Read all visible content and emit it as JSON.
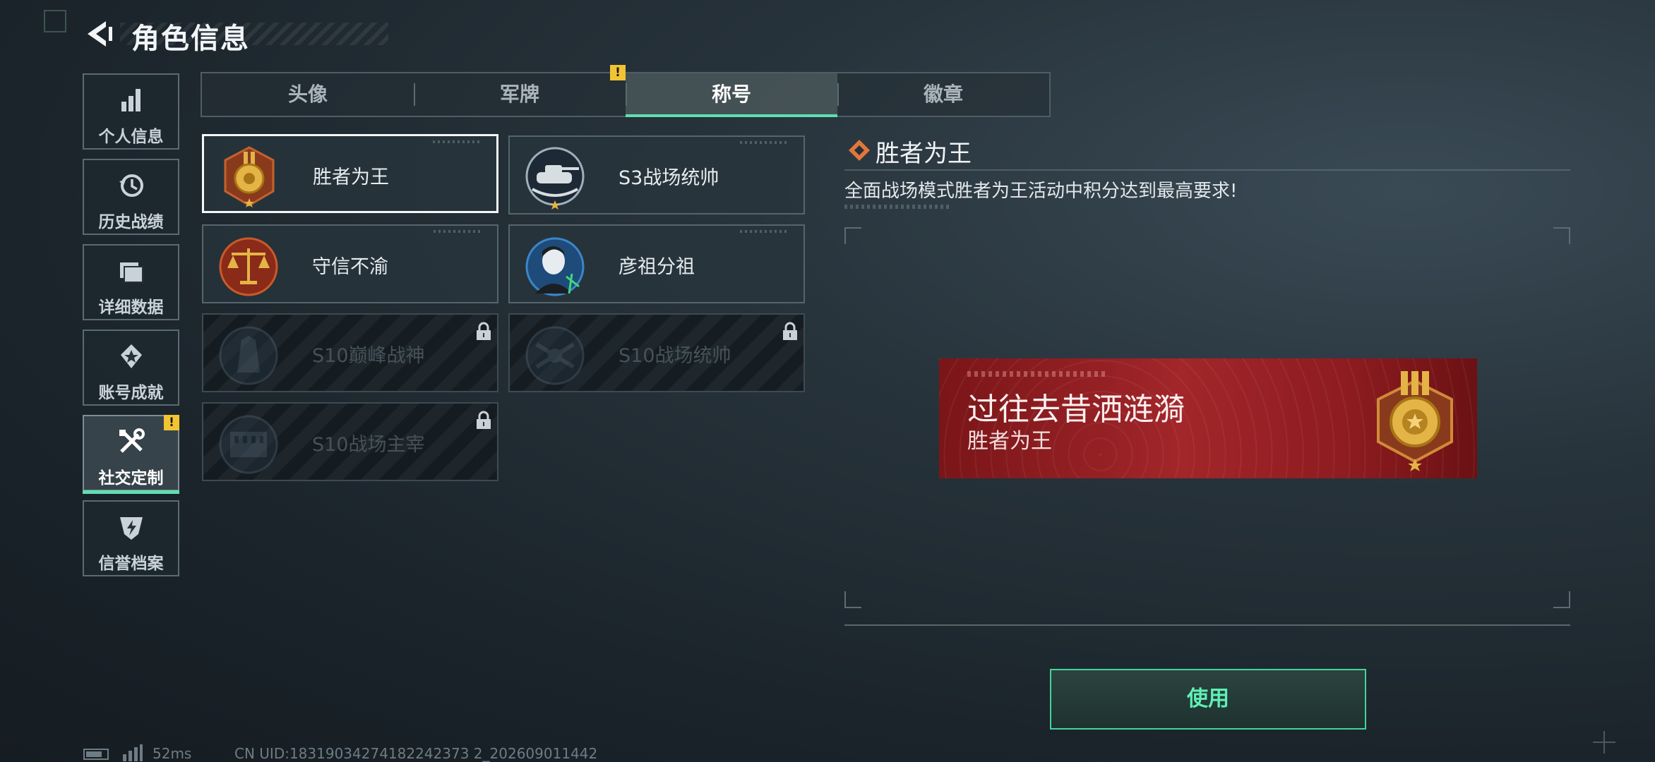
{
  "header": {
    "title": "角色信息",
    "back_icon": "back-arrow-icon"
  },
  "sidebar": {
    "items": [
      {
        "label": "个人信息",
        "icon": "bar-chart-icon",
        "active": false
      },
      {
        "label": "历史战绩",
        "icon": "history-clock-icon",
        "active": false
      },
      {
        "label": "详细数据",
        "icon": "folder-icon",
        "active": false
      },
      {
        "label": "账号成就",
        "icon": "achievement-icon",
        "active": false
      },
      {
        "label": "社交定制",
        "icon": "tools-icon",
        "active": true,
        "badge": "!"
      },
      {
        "label": "信誉档案",
        "icon": "credit-shield-icon",
        "active": false
      }
    ]
  },
  "tabs": [
    {
      "label": "头像",
      "active": false
    },
    {
      "label": "军牌",
      "active": false,
      "badge": "!"
    },
    {
      "label": "称号",
      "active": true
    },
    {
      "label": "徽章",
      "active": false
    }
  ],
  "titles": [
    {
      "name": "胜者为王",
      "locked": false,
      "selected": true,
      "icon": "gold-medal-icon"
    },
    {
      "name": "S3战场统帅",
      "locked": false,
      "selected": false,
      "icon": "tank-emblem-icon"
    },
    {
      "name": "守信不渝",
      "locked": false,
      "selected": false,
      "icon": "scales-emblem-icon"
    },
    {
      "name": "彦祖分祖",
      "locked": false,
      "selected": false,
      "icon": "portrait-emblem-icon"
    },
    {
      "name": "S10巅峰战神",
      "locked": true,
      "selected": false,
      "icon": "monument-emblem-icon"
    },
    {
      "name": "S10战场统帅",
      "locked": true,
      "selected": false,
      "icon": "drone-emblem-icon"
    },
    {
      "name": "S10战场主宰",
      "locked": true,
      "selected": false,
      "icon": "colosseum-emblem-icon"
    }
  ],
  "detail": {
    "title": "胜者为王",
    "description": "全面战场模式胜者为王活动中积分达到最高要求!",
    "preview": {
      "main_text": "过往去昔洒涟漪",
      "sub_text": "胜者为王"
    }
  },
  "use_button": {
    "label": "使用"
  },
  "status_bar": {
    "ping": "52ms",
    "uid": "CN UID:18319034274182242373 2_202609011442"
  },
  "colors": {
    "accent": "#5fe0b0",
    "banner_red": "#a2262a",
    "warning": "#f2c433",
    "gold": "#d9a53a"
  }
}
